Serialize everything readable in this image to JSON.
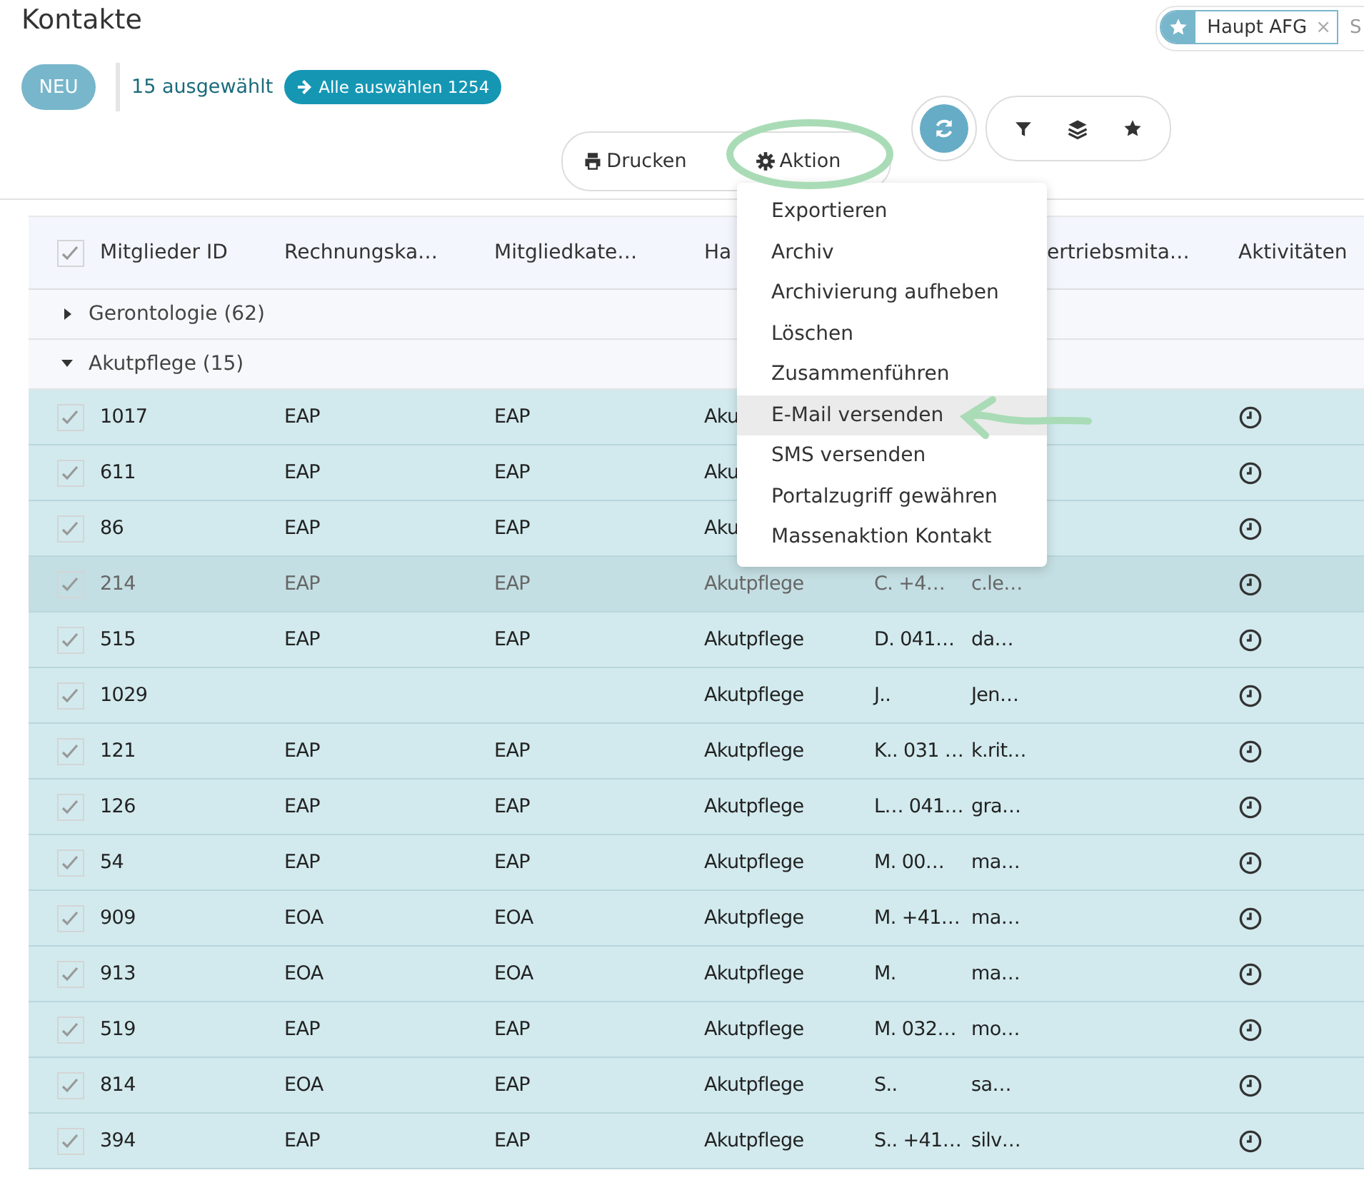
{
  "page": {
    "title": "Kontakte"
  },
  "favorite_filter": {
    "label": "Haupt AFG",
    "remove": "×"
  },
  "search": {
    "placeholder": "S"
  },
  "new_button": "NEU",
  "selection": {
    "count_text": "15 ausgewählt",
    "select_all": "Alle auswählen 1254"
  },
  "actions": [
    {
      "label": "Drucken",
      "kind": "print"
    },
    {
      "label": "Aktion",
      "kind": "action"
    }
  ],
  "action_menu": {
    "open": true,
    "items": [
      {
        "label": "Exportieren",
        "selected": false
      },
      {
        "label": "Archiv",
        "selected": false
      },
      {
        "label": "Archivierung aufheben",
        "selected": false
      },
      {
        "label": "Löschen",
        "selected": false
      },
      {
        "label": "Zusammenführen",
        "selected": false
      },
      {
        "label": "E-Mail versenden",
        "selected": true
      },
      {
        "label": "SMS versenden",
        "selected": false
      },
      {
        "label": "Portalzugriff gewähren",
        "selected": false
      },
      {
        "label": "Massenaktion Kontakt",
        "selected": false
      }
    ]
  },
  "table": {
    "header_checked": true,
    "columns": [
      "Mitglieder ID",
      "Rechnungska…",
      "Mitgliedkate…",
      "Ha",
      "ertriebsmita…",
      "Aktivitäten"
    ],
    "groups": [
      {
        "label": "Gerontologie (62)",
        "expanded": false
      },
      {
        "label": "Akutpflege (15)",
        "expanded": true,
        "rows": [
          {
            "checked": true,
            "hovered": false,
            "id": "1017",
            "column_2": "EAP",
            "column_3": "EAP",
            "column_4": "Aku"
          },
          {
            "checked": true,
            "hovered": false,
            "id": "611",
            "column_2": "EAP",
            "column_3": "EAP",
            "column_4": "Aku"
          },
          {
            "checked": true,
            "hovered": false,
            "id": "86",
            "column_2": "EAP",
            "column_3": "EAP",
            "column_4": "Aku"
          },
          {
            "checked": true,
            "hovered": true,
            "id": "214",
            "column_2": "EAP",
            "column_3": "EAP",
            "column_4": "Akutpflege",
            "column_5": "C. +4…",
            "column_6": "c.le…"
          },
          {
            "checked": true,
            "hovered": false,
            "id": "515",
            "column_2": "EAP",
            "column_3": "EAP",
            "column_4": "Akutpflege",
            "column_5": "D. 041…",
            "column_6": "da…"
          },
          {
            "checked": true,
            "hovered": false,
            "id": "1029",
            "column_4": "Akutpflege",
            "column_5": "J..",
            "column_6": "Jen…"
          },
          {
            "checked": true,
            "hovered": false,
            "id": "121",
            "column_2": "EAP",
            "column_3": "EAP",
            "column_4": "Akutpflege",
            "column_5": "K.. 031 …",
            "column_6": "k.rit…"
          },
          {
            "checked": true,
            "hovered": false,
            "id": "126",
            "column_2": "EAP",
            "column_3": "EAP",
            "column_4": "Akutpflege",
            "column_5": "L… 041…",
            "column_6": "gra…"
          },
          {
            "checked": true,
            "hovered": false,
            "id": "54",
            "column_2": "EAP",
            "column_3": "EAP",
            "column_4": "Akutpflege",
            "column_5": "M. 00…",
            "column_6": "ma…"
          },
          {
            "checked": true,
            "hovered": false,
            "id": "909",
            "column_2": "EOA",
            "column_3": "EOA",
            "column_4": "Akutpflege",
            "column_5": "M. +41…",
            "column_6": "ma…"
          },
          {
            "checked": true,
            "hovered": false,
            "id": "913",
            "column_2": "EOA",
            "column_3": "EOA",
            "column_4": "Akutpflege",
            "column_5": "M.",
            "column_6": "ma…"
          },
          {
            "checked": true,
            "hovered": false,
            "id": "519",
            "column_2": "EAP",
            "column_3": "EAP",
            "column_4": "Akutpflege",
            "column_5": "M. 032…",
            "column_6": "mo…"
          },
          {
            "checked": true,
            "hovered": false,
            "id": "814",
            "column_2": "EOA",
            "column_3": "EAP",
            "column_4": "Akutpflege",
            "column_5": "S..",
            "column_6": "sa…"
          },
          {
            "checked": true,
            "hovered": false,
            "id": "394",
            "column_2": "EAP",
            "column_3": "EAP",
            "column_4": "Akutpflege",
            "column_5": "S.. +41…",
            "column_6": "silv…"
          }
        ]
      }
    ]
  }
}
